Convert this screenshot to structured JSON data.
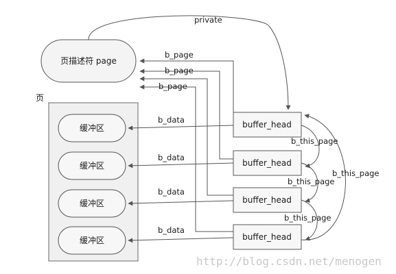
{
  "diagram": {
    "page_descriptor_label": "页描述符 page",
    "page_label": "页",
    "buffer_labels": [
      "缓冲区",
      "缓冲区",
      "缓冲区",
      "缓冲区"
    ],
    "buffer_head_labels": [
      "buffer_head",
      "buffer_head",
      "buffer_head",
      "buffer_head"
    ],
    "edge_private": "private",
    "edge_b_page": [
      "b_page",
      "b_page",
      "b_page"
    ],
    "edge_b_data": [
      "b_data",
      "b_data",
      "b_data",
      "b_data"
    ],
    "edge_b_this_page": [
      "b_this_page",
      "b_this_page",
      "b_this_page",
      "b_this_page"
    ],
    "watermark": "http://blog.csdn.net/menogen",
    "colors": {
      "stroke": "#555555",
      "box_fill": "#f4f4f4",
      "container_fill": "#f0f0f0",
      "watermark": "#c8c8c8"
    }
  }
}
